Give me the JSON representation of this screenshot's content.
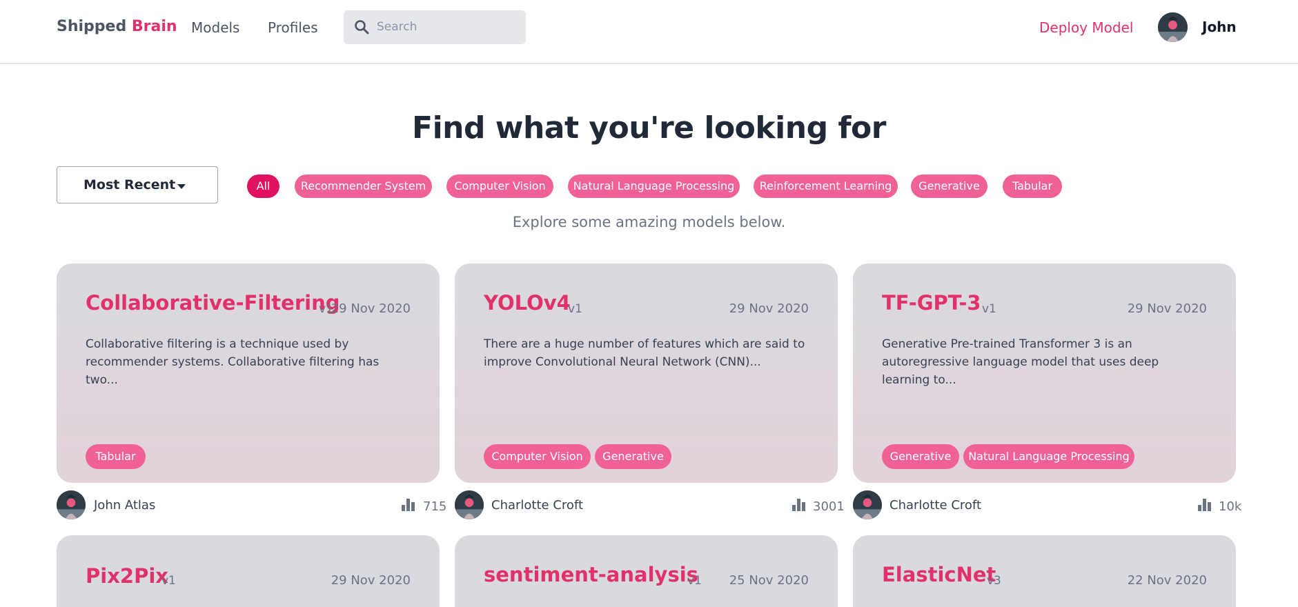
{
  "header": {
    "brand_primary": "Shipped",
    "brand_accent": "Brain",
    "nav": [
      "Models",
      "Profiles"
    ],
    "search_placeholder": "Search",
    "deploy_label": "Deploy Model",
    "user_name": "John"
  },
  "hero": {
    "title": "Find what you're looking for",
    "sort_label": "Most Recent",
    "subtitle": "Explore some amazing models below."
  },
  "filters": [
    "All",
    "Recommender System",
    "Computer Vision",
    "Natural Language Processing",
    "Reinforcement Learning",
    "Generative",
    "Tabular"
  ],
  "active_filter": "All",
  "cards": [
    {
      "title": "Collaborative-Filtering",
      "version": "v1",
      "date": "29 Nov 2020",
      "description": "Collaborative filtering is a technique used by recommender systems. Collaborative filtering has two...",
      "tags": [
        "Tabular"
      ],
      "author": "John Atlas",
      "views": "715"
    },
    {
      "title": "YOLOv4",
      "version": "v1",
      "date": "29 Nov 2020",
      "description": "There are a huge number of features which are said to improve Convolutional Neural Network (CNN)...",
      "tags": [
        "Computer Vision",
        "Generative"
      ],
      "author": "Charlotte Croft",
      "views": "3001"
    },
    {
      "title": "TF-GPT-3",
      "version": "v1",
      "date": "29 Nov 2020",
      "description": "Generative Pre-trained Transformer 3 is an autoregressive language model that uses deep learning to...",
      "tags": [
        "Generative",
        "Natural Language Processing"
      ],
      "author": "Charlotte Croft",
      "views": "10k"
    },
    {
      "title": "Pix2Pix",
      "version": "v1",
      "date": "29 Nov 2020"
    },
    {
      "title": "sentiment-analysis",
      "version": "v1",
      "date": "25 Nov 2020"
    },
    {
      "title": "ElasticNet",
      "version": "v3",
      "date": "22 Nov 2020"
    }
  ],
  "colors": {
    "accent": "#e0316b",
    "pill": "#f06295",
    "pill_active": "#e0115f"
  },
  "icons": [
    "search-icon",
    "bar-chart-icon",
    "avatar",
    "caret-down-icon"
  ]
}
